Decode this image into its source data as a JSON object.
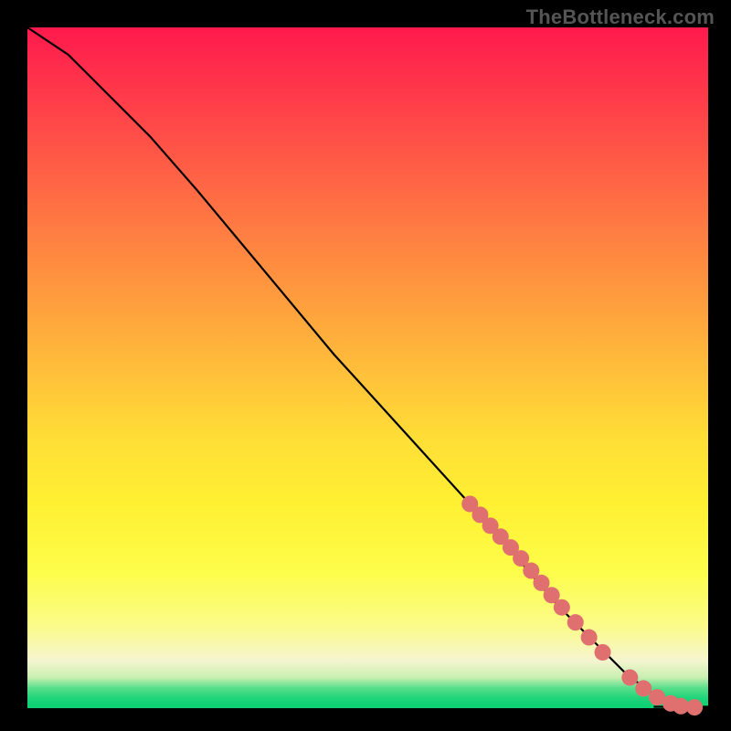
{
  "watermark": "TheBottleneck.com",
  "chart_data": {
    "type": "line",
    "title": "",
    "xlabel": "",
    "ylabel": "",
    "xlim": [
      0,
      100
    ],
    "ylim": [
      0,
      100
    ],
    "grid": false,
    "legend": false,
    "curve": {
      "name": "bottleneck-curve",
      "x": [
        0,
        3,
        6,
        9,
        12,
        18,
        25,
        35,
        45,
        55,
        65,
        72,
        78,
        83,
        88,
        92,
        95,
        97,
        99,
        100
      ],
      "y": [
        100,
        98,
        96,
        93,
        90,
        84,
        76,
        64,
        52,
        41,
        30,
        22,
        15,
        10,
        5,
        2,
        0.8,
        0.3,
        0.1,
        0.05
      ]
    },
    "markers": {
      "name": "highlighted-segment",
      "color": "#e07070",
      "radius": 9,
      "x": [
        65,
        66.5,
        68,
        69.5,
        71,
        72.5,
        74,
        75.5,
        77,
        78.5,
        80.5,
        82.5,
        84.5,
        88.5,
        90.5,
        92.5,
        94.5,
        96,
        98
      ],
      "y": [
        30,
        28.4,
        26.8,
        25.2,
        23.6,
        22,
        20.2,
        18.4,
        16.6,
        14.8,
        12.6,
        10.4,
        8.2,
        4.5,
        2.9,
        1.6,
        0.7,
        0.3,
        0.12
      ]
    }
  }
}
